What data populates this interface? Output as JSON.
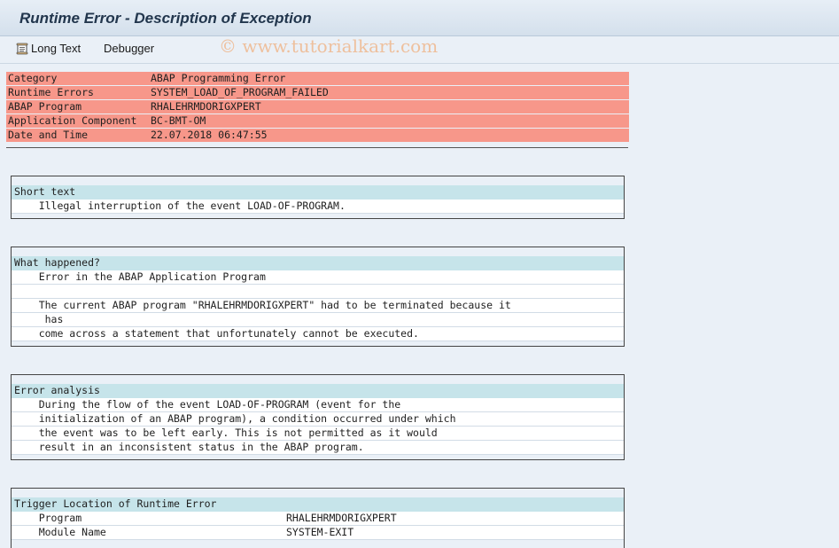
{
  "window": {
    "title": "Runtime Error - Description of Exception"
  },
  "toolbar": {
    "long_text_label": "Long Text",
    "debugger_label": "Debugger"
  },
  "watermark": "© www.tutorialkart.com",
  "header": [
    {
      "key": "Category",
      "value": "ABAP Programming Error"
    },
    {
      "key": "Runtime Errors",
      "value": "SYSTEM_LOAD_OF_PROGRAM_FAILED"
    },
    {
      "key": "ABAP Program",
      "value": "RHALEHRMDORIGXPERT"
    },
    {
      "key": "Application Component",
      "value": "BC-BMT-OM"
    },
    {
      "key": "Date and Time",
      "value": "22.07.2018 06:47:55"
    }
  ],
  "short_text": {
    "heading": "Short text",
    "lines": [
      "    Illegal interruption of the event LOAD-OF-PROGRAM."
    ]
  },
  "what_happened": {
    "heading": "What happened?",
    "lines": [
      "    Error in the ABAP Application Program",
      "",
      "    The current ABAP program \"RHALEHRMDORIGXPERT\" had to be terminated because it",
      "     has",
      "    come across a statement that unfortunately cannot be executed."
    ]
  },
  "error_analysis": {
    "heading": "Error analysis",
    "lines": [
      "    During the flow of the event LOAD-OF-PROGRAM (event for the",
      "    initialization of an ABAP program), a condition occurred under which",
      "    the event was to be left early. This is not permitted as it would",
      "    result in an inconsistent status in the ABAP program."
    ]
  },
  "trigger_location": {
    "heading": "Trigger Location of Runtime Error",
    "rows": [
      {
        "label": "    Program",
        "value": "RHALEHRMDORIGXPERT"
      },
      {
        "label": "    Module Name",
        "value": "SYSTEM-EXIT"
      }
    ]
  }
}
